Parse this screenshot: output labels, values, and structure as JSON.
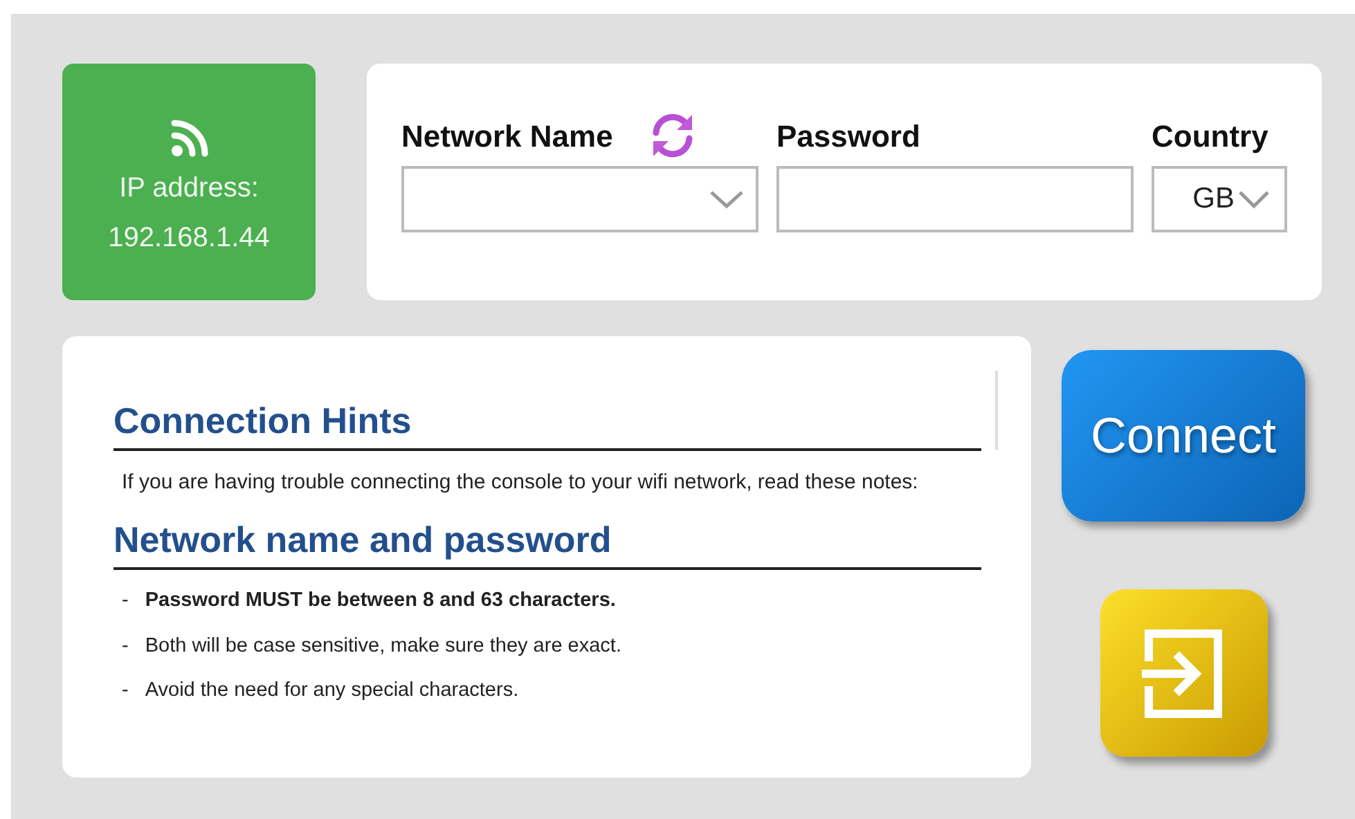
{
  "status_card": {
    "label": "IP address:",
    "ip": "192.168.1.44"
  },
  "wifi_form": {
    "network_name": {
      "label": "Network Name"
    },
    "password": {
      "label": "Password"
    },
    "country": {
      "label": "Country",
      "value": "GB"
    }
  },
  "hints": {
    "title": "Connection Hints",
    "intro": "If you are having trouble connecting the console to your wifi network, read these notes:",
    "section_title": "Network name and password",
    "items": [
      {
        "text": "Password MUST be between 8 and 63 characters.",
        "emphasis": true
      },
      {
        "text": "Both will be case sensitive, make sure they are exact.",
        "emphasis": false
      },
      {
        "text": "Avoid the need for any special characters.",
        "emphasis": false
      }
    ],
    "bullet": "-"
  },
  "connect_button": {
    "label": "Connect"
  }
}
